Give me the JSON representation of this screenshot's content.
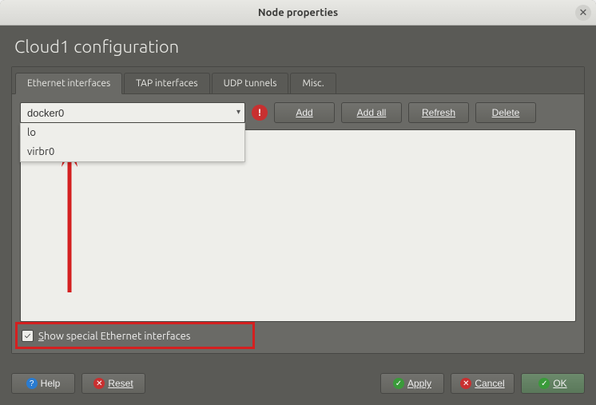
{
  "window": {
    "title": "Node properties"
  },
  "group": {
    "title": "Cloud1 configuration"
  },
  "tabs": [
    {
      "label": "Ethernet interfaces",
      "active": true
    },
    {
      "label": "TAP interfaces",
      "active": false
    },
    {
      "label": "UDP tunnels",
      "active": false
    },
    {
      "label": "Misc.",
      "active": false
    }
  ],
  "combo": {
    "value": "docker0",
    "options": [
      "lo",
      "virbr0"
    ]
  },
  "toolbar": {
    "add": "Add",
    "addall": "Add all",
    "refresh": "Refresh",
    "delete": "Delete"
  },
  "checkbox": {
    "checked": true,
    "label_pre": "S",
    "label_rest": "how special Ethernet interfaces"
  },
  "footer": {
    "help": "Help",
    "reset": "Reset",
    "apply": "Apply",
    "cancel": "Cancel",
    "ok": "OK"
  },
  "colors": {
    "highlight": "#d42020"
  }
}
